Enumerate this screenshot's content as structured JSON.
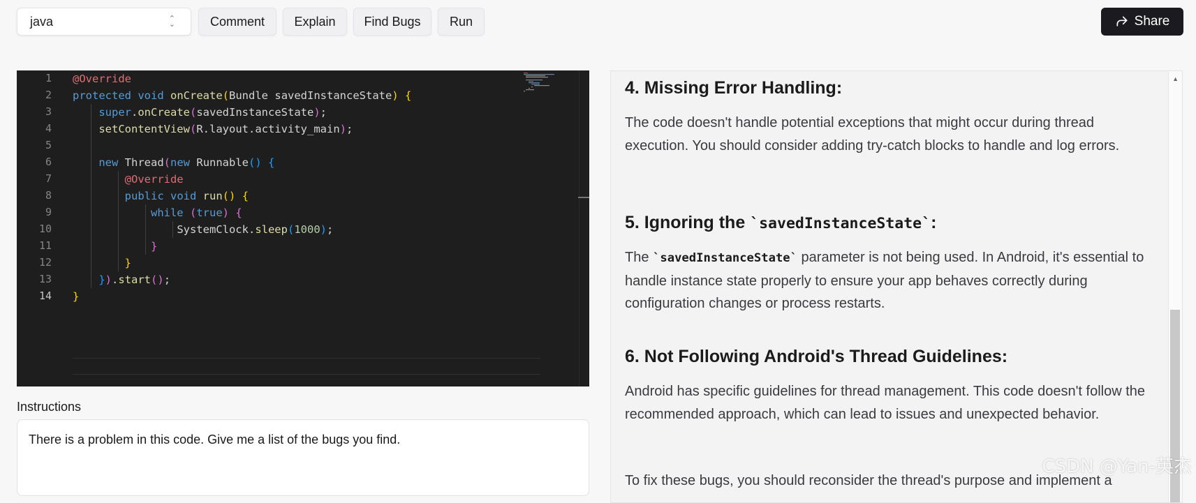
{
  "toolbar": {
    "language": "java",
    "buttons": [
      "Comment",
      "Explain",
      "Find Bugs",
      "Run"
    ],
    "share_label": "Share"
  },
  "editor": {
    "line_numbers": [
      "1",
      "2",
      "3",
      "4",
      "5",
      "6",
      "7",
      "8",
      "9",
      "10",
      "11",
      "12",
      "13",
      "14"
    ],
    "active_line": "14"
  },
  "instructions": {
    "label": "Instructions",
    "value": "There is a problem in this code. Give me a list of the bugs you find."
  },
  "result": {
    "h4": "4. Missing Error Handling:",
    "p4": "The code doesn't handle potential exceptions that might occur during thread execution. You should consider adding try-catch blocks to handle and log errors.",
    "h5_prefix": "5. Ignoring the ",
    "h5_code": "`savedInstanceState`",
    "h5_suffix": ":",
    "p5_prefix": "The ",
    "p5_code": "`savedInstanceState`",
    "p5_suffix": " parameter is not being used. In Android, it's essential to handle instance state properly to ensure your app behaves correctly during configuration changes or process restarts.",
    "h6": "6. Not Following Android's Thread Guidelines:",
    "p6": "Android has specific guidelines for thread management. This code doesn't follow the recommended approach, which can lead to issues and unexpected behavior.",
    "p7": "To fix these bugs, you should reconsider the thread's purpose and implement a"
  },
  "watermark": "CSDN @Yan-英杰"
}
